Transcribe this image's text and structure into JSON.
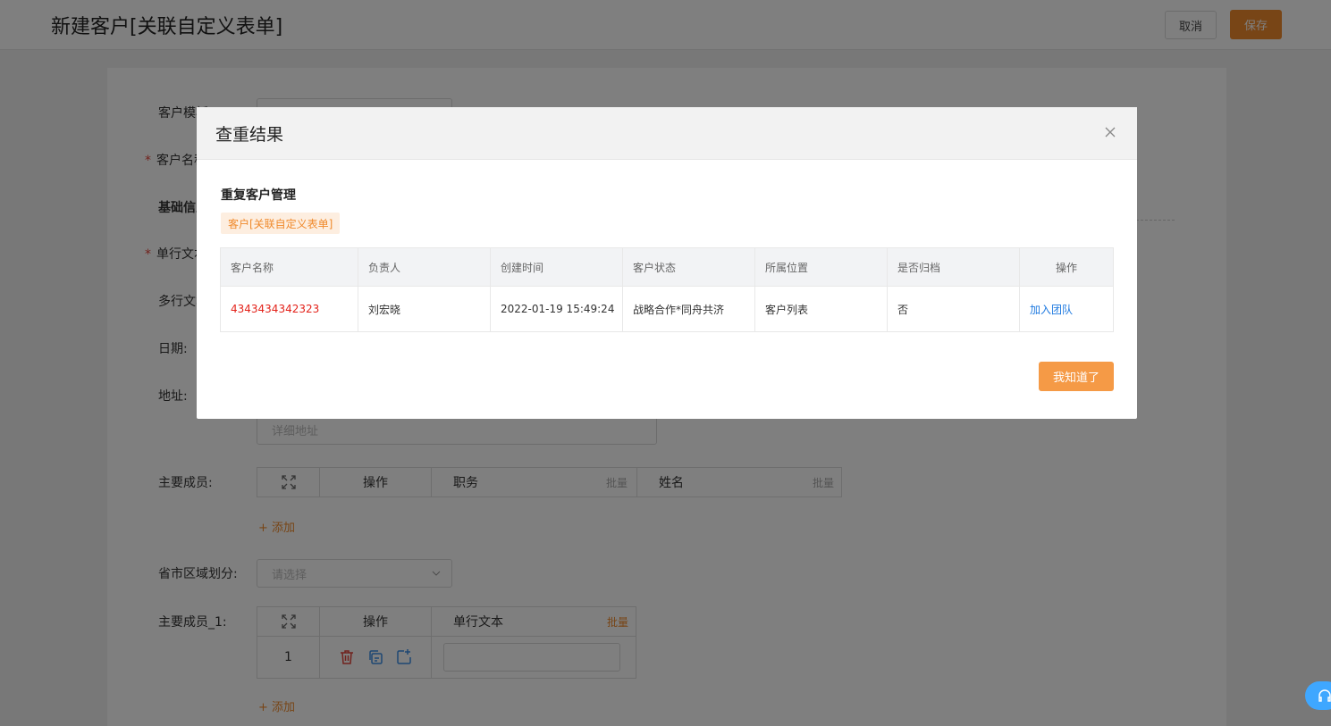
{
  "header": {
    "title": "新建客户[关联自定义表单]",
    "cancel": "取消",
    "save": "保存"
  },
  "form": {
    "template_label": "客户模板:",
    "name_label": "客户名称:",
    "section_basic": "基础信息",
    "single_text_label": "单行文本:",
    "multi_text_label": "多行文本:",
    "date_label": "日期:",
    "address_label": "地址:",
    "address_placeholder": "详细地址",
    "members_label": "主要成员:",
    "members_table": {
      "col_op": "操作",
      "col_title": "职务",
      "col_name": "姓名",
      "batch": "批量"
    },
    "add": "添加",
    "region_label": "省市区域划分:",
    "region_placeholder": "请选择",
    "members1_label": "主要成员_1:",
    "members1_table": {
      "col_op": "操作",
      "col_text": "单行文本",
      "batch": "批量",
      "row_index": "1"
    },
    "add2": "添加"
  },
  "modal": {
    "title": "查重结果",
    "section_title": "重复客户管理",
    "tag": "客户[关联自定义表单]",
    "columns": [
      "客户名称",
      "负责人",
      "创建时间",
      "客户状态",
      "所属位置",
      "是否归档",
      "操作"
    ],
    "row": {
      "name": "4343434342323",
      "owner": "刘宏晓",
      "created": "2022-01-19 15:49:24",
      "status": "战略合作*同舟共济",
      "location": "客户列表",
      "archived": "否",
      "action": "加入团队"
    },
    "ok_button": "我知道了"
  },
  "colors": {
    "accent": "#f08a2c",
    "link": "#1f7ae0",
    "danger": "#e3221a"
  }
}
